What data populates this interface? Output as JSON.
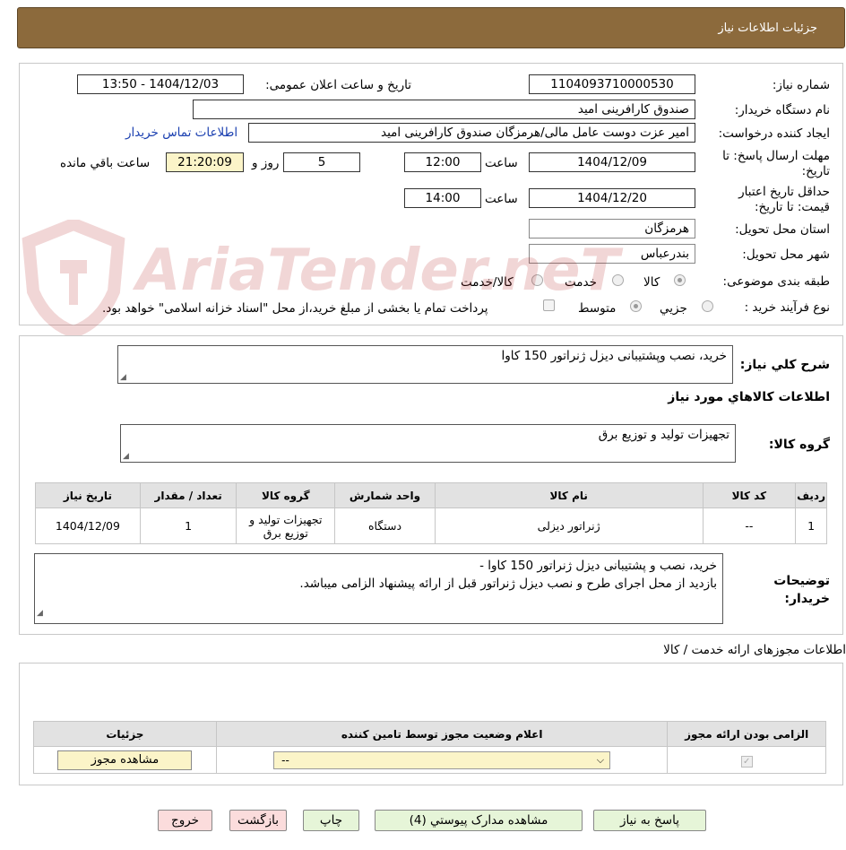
{
  "header": {
    "title": "جزئیات اطلاعات نیاز"
  },
  "form": {
    "need_number_label": "شماره نیاز:",
    "need_number": "1104093710000530",
    "announce_label": "تاریخ و ساعت اعلان عمومی:",
    "announce_value": "1404/12/03 - 13:50",
    "buyer_org_label": "نام دستگاه خریدار:",
    "buyer_org": "صندوق کارافرینی امید",
    "requester_label": "ایجاد کننده درخواست:",
    "requester": "امیر عزت دوست عامل مالی/هرمزگان صندوق کارافرینی امید",
    "contact_link": "اطلاعات تماس خریدار",
    "deadline_label": "مهلت ارسال پاسخ: تا تاریخ:",
    "deadline_date": "1404/12/09",
    "time_label": "ساعت",
    "deadline_time": "12:00",
    "days_value": "5",
    "days_label": "روز و",
    "remaining_time": "21:20:09",
    "remaining_label": "ساعت باقي مانده",
    "validity_label": "حداقل تاریخ اعتبار قیمت: تا تاریخ:",
    "validity_date": "1404/12/20",
    "validity_time": "14:00",
    "province_label": "استان محل تحویل:",
    "province": "هرمزگان",
    "city_label": "شهر محل تحویل:",
    "city": "بندرعباس",
    "category_label": "طبقه بندی موضوعی:",
    "category_options": [
      "کالا",
      "خدمت",
      "کالا/خدمت"
    ],
    "process_label": "نوع فرآیند خرید :",
    "process_options": [
      "جزیي",
      "متوسط"
    ],
    "payment_note": "پرداخت تمام یا بخشی از مبلغ خرید،از محل \"اسناد خزانه اسلامی\" خواهد بود."
  },
  "summary": {
    "desc_label": "شرح کلي نياز:",
    "desc_value": "خرید، نصب وپشتیبانی دیزل ژنراتور 150 کاوا",
    "goods_info_title": "اطلاعات کالاهاي مورد نياز",
    "goods_group_label": "گروه کالا:",
    "goods_group_value": "تجهیزات تولید و توزیع برق"
  },
  "goods_table": {
    "headers": [
      "رديف",
      "کد کالا",
      "نام کالا",
      "واحد شمارش",
      "گروه کالا",
      "تعداد / مقدار",
      "تاریخ نیاز"
    ],
    "rows": [
      [
        "1",
        "--",
        "ژنراتور دیزلی",
        "دستگاه",
        "تجهیزات تولید و توزیع برق",
        "1",
        "1404/12/09"
      ]
    ]
  },
  "buyer_notes": {
    "label": "توضیحات خریدار:",
    "line1": "خرید، نصب و پشتیبانی دیزل ژنراتور 150 کاوا -",
    "line2": "بازدید از محل اجرای طرح و نصب دیزل ژنراتور قبل از ارائه پیشنهاد الزامی میباشد."
  },
  "permits": {
    "title": "اطلاعات مجوزهای ارائه خدمت / کالا",
    "headers": [
      "الزامی بودن ارائه مجوز",
      "اعلام وضعیت مجوز توسط تامین کننده",
      "جزئیات"
    ],
    "select_value": "--",
    "view_button": "مشاهده مجوز"
  },
  "buttons": {
    "reply": "پاسخ به نیاز",
    "attachments": "مشاهده مدارک پیوستي (4)",
    "print": "چاپ",
    "back": "بازگشت",
    "exit": "خروج"
  },
  "watermark": "AriaTender.neT",
  "colors": {
    "header_bg": "#8c6a3c",
    "link": "#1a3fb0",
    "yellow": "#fbf4c8",
    "green_btn": "#e6f5d8",
    "pink_btn": "#fbdcdc"
  }
}
